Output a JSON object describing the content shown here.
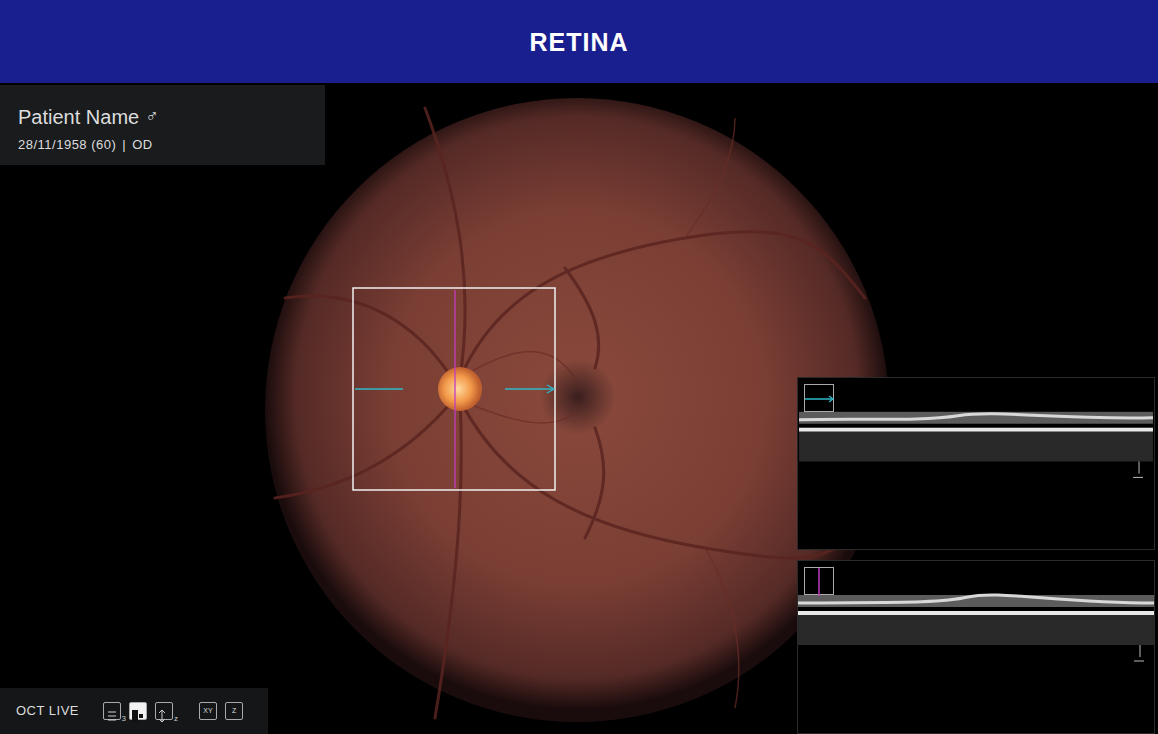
{
  "banner": {
    "title": "RETINA"
  },
  "patient": {
    "name": "Patient Name",
    "sex": "♂",
    "dob": "28/11/1958 (60)",
    "separator": "|",
    "eye": "OD"
  },
  "toolbar": {
    "label": "OCT LIVE",
    "icon_buttons": [
      {
        "kind": "list",
        "sub": "3",
        "selected": false
      },
      {
        "kind": "split",
        "sub": "",
        "selected": true
      },
      {
        "kind": "depth",
        "sub": "z",
        "selected": false
      }
    ],
    "buttons": [
      {
        "label": "XY",
        "selected": false
      },
      {
        "label": "Z",
        "selected": false
      }
    ]
  },
  "scans": [
    {
      "kind": "horizontal",
      "color": "#2fb8c8"
    },
    {
      "kind": "vertical",
      "color": "#c23cc0"
    }
  ]
}
